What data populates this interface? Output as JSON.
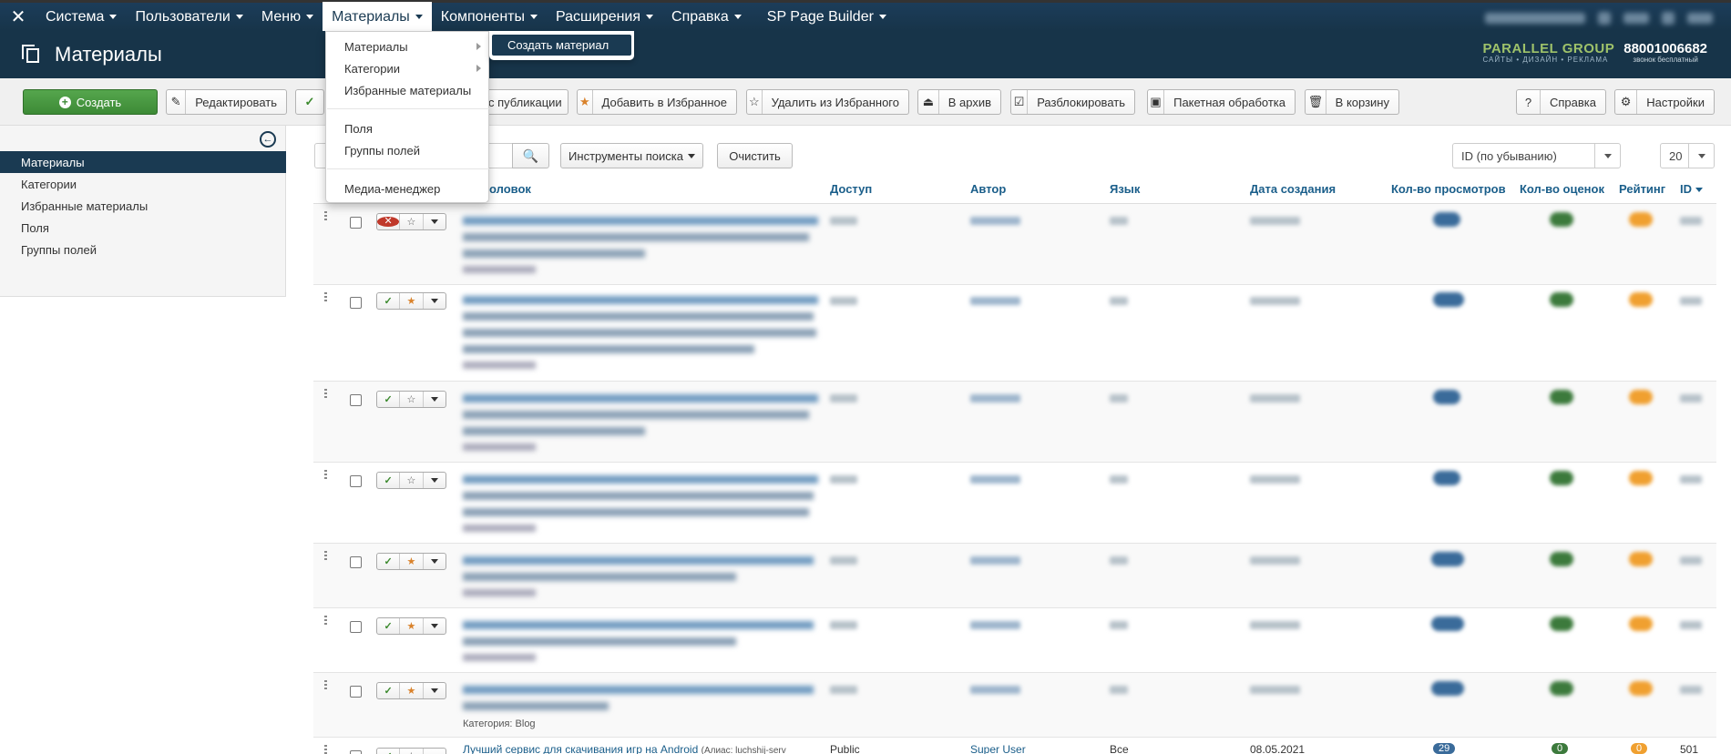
{
  "topnav": {
    "items": [
      {
        "label": "Система"
      },
      {
        "label": "Пользователи"
      },
      {
        "label": "Меню"
      },
      {
        "label": "Материалы"
      },
      {
        "label": "Компоненты"
      },
      {
        "label": "Расширения"
      },
      {
        "label": "Справка"
      },
      {
        "label": "SP Page Builder"
      }
    ]
  },
  "header": {
    "title": "Материалы",
    "brand_name": "PARALLEL GROUP",
    "brand_tagline": "САЙТЫ • ДИЗАЙН • РЕКЛАМА",
    "phone": "88001006682",
    "phone_note": "звонок бесплатный"
  },
  "toolbar": {
    "create": "Создать",
    "edit": "Редактировать",
    "unpublish": "с публикации",
    "add_featured": "Добавить в Избранное",
    "remove_featured": "Удалить из Избранного",
    "archive": "В архив",
    "unlock": "Разблокировать",
    "batch": "Пакетная обработка",
    "trash": "В корзину",
    "help": "Справка",
    "options": "Настройки"
  },
  "sidebar": {
    "items": [
      {
        "label": "Материалы"
      },
      {
        "label": "Категории"
      },
      {
        "label": "Избранные материалы"
      },
      {
        "label": "Поля"
      },
      {
        "label": "Группы полей"
      }
    ]
  },
  "filters": {
    "search_tools": "Инструменты поиска",
    "clear": "Очистить",
    "ordering": "ID (по убыванию)",
    "limit": "20"
  },
  "table": {
    "headers": {
      "title": "оловок",
      "access": "Доступ",
      "author": "Автор",
      "language": "Язык",
      "created": "Дата создания",
      "hits": "Кол-во просмотров",
      "votes": "Кол-во оценок",
      "rating": "Рейтинг",
      "id": "ID"
    },
    "last_category": "Категория: Blog",
    "last_row": {
      "title": "Лучший сервис для скачивания игр на Android",
      "alias": "(Алиас: luchshij-serv",
      "access": "Public",
      "author": "Super User",
      "language": "Все",
      "created": "08.05.2021",
      "hits": "29",
      "votes": "0",
      "rating": "0",
      "id": "501"
    }
  },
  "menu": {
    "items": [
      {
        "label": "Материалы"
      },
      {
        "label": "Категории"
      },
      {
        "label": "Избранные материалы"
      },
      {
        "label": "Поля"
      },
      {
        "label": "Группы полей"
      },
      {
        "label": "Медиа-менеджер"
      }
    ],
    "submenu_item": "Создать материал"
  }
}
